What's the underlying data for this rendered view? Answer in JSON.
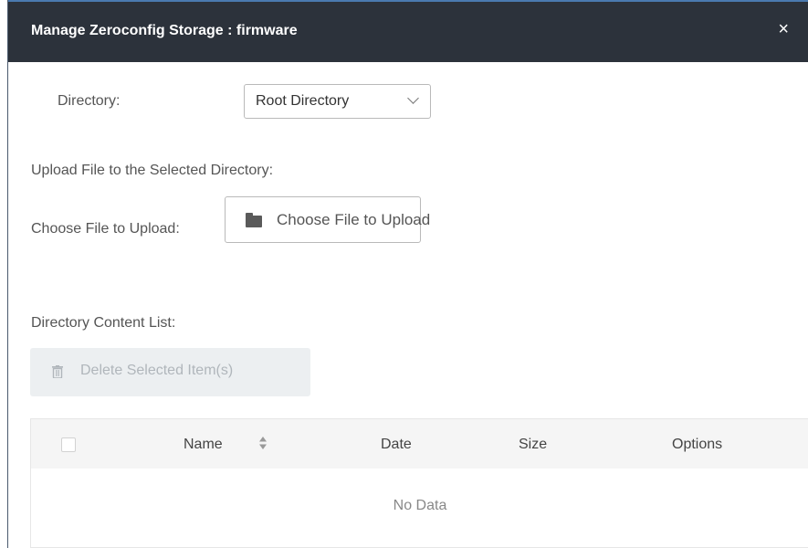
{
  "dialog": {
    "title": "Manage Zeroconfig Storage : firmware",
    "close_glyph": "×"
  },
  "directory": {
    "label": "Directory:",
    "selected": "Root Directory",
    "icon": "chevron-down-icon"
  },
  "upload": {
    "heading": "Upload File to the Selected Directory:",
    "choose_label": "Choose File to Upload:",
    "button_label": "Choose File to Upload",
    "icon": "folder-icon"
  },
  "content": {
    "heading": "Directory Content List:",
    "delete_label": "Delete Selected Item(s)",
    "delete_icon": "trash-icon"
  },
  "table": {
    "columns": [
      "Name",
      "Date",
      "Size",
      "Options"
    ],
    "sort_icon": "sort-icon",
    "empty_text": "No Data"
  },
  "colors": {
    "titlebar_bg": "#2c323b",
    "titlebar_accent": "#4a7ab0",
    "disabled_text": "#b0b6bb"
  }
}
